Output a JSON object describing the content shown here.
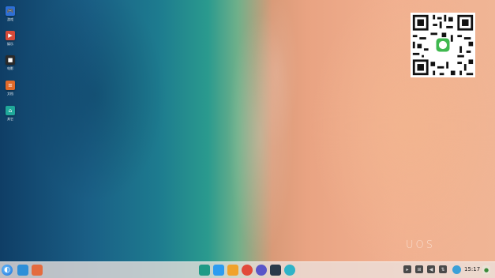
{
  "desktop": {
    "icons": [
      {
        "label": "游戏",
        "glyph": "🎮",
        "color": "#2d6fd6"
      },
      {
        "label": "娱乐",
        "glyph": "▶",
        "color": "#d64a3a"
      },
      {
        "label": "电影",
        "glyph": "■",
        "color": "#2a2a2a"
      },
      {
        "label": "文档",
        "glyph": "≡",
        "color": "#e06a2a"
      },
      {
        "label": "其它",
        "glyph": "⌂",
        "color": "#20a89a"
      }
    ]
  },
  "watermark": {
    "text": "UOS"
  },
  "dock": {
    "launcher": {
      "icon": "launcher-icon"
    },
    "left_apps": [
      {
        "name": "multitask-view",
        "color": "#2e8fd8"
      },
      {
        "name": "desktop-view",
        "color": "#e46b3e"
      }
    ],
    "center_apps": [
      {
        "name": "terminal",
        "color": "#1f9a86"
      },
      {
        "name": "app-store",
        "color": "#2c9cf0"
      },
      {
        "name": "file-manager",
        "color": "#f1a22b"
      },
      {
        "name": "chrome",
        "color": "#e24a3a"
      },
      {
        "name": "browser",
        "color": "#5a55c8"
      },
      {
        "name": "monitor",
        "color": "#2a3a4a"
      },
      {
        "name": "deepin-music",
        "color": "#2fb3c7"
      }
    ],
    "tray": [
      {
        "name": "tray-app-1",
        "glyph": "▸"
      },
      {
        "name": "tray-app-2",
        "glyph": "⊞"
      },
      {
        "name": "tray-volume",
        "glyph": "◀"
      },
      {
        "name": "tray-network",
        "glyph": "⇅"
      }
    ],
    "clock": "15:17"
  }
}
